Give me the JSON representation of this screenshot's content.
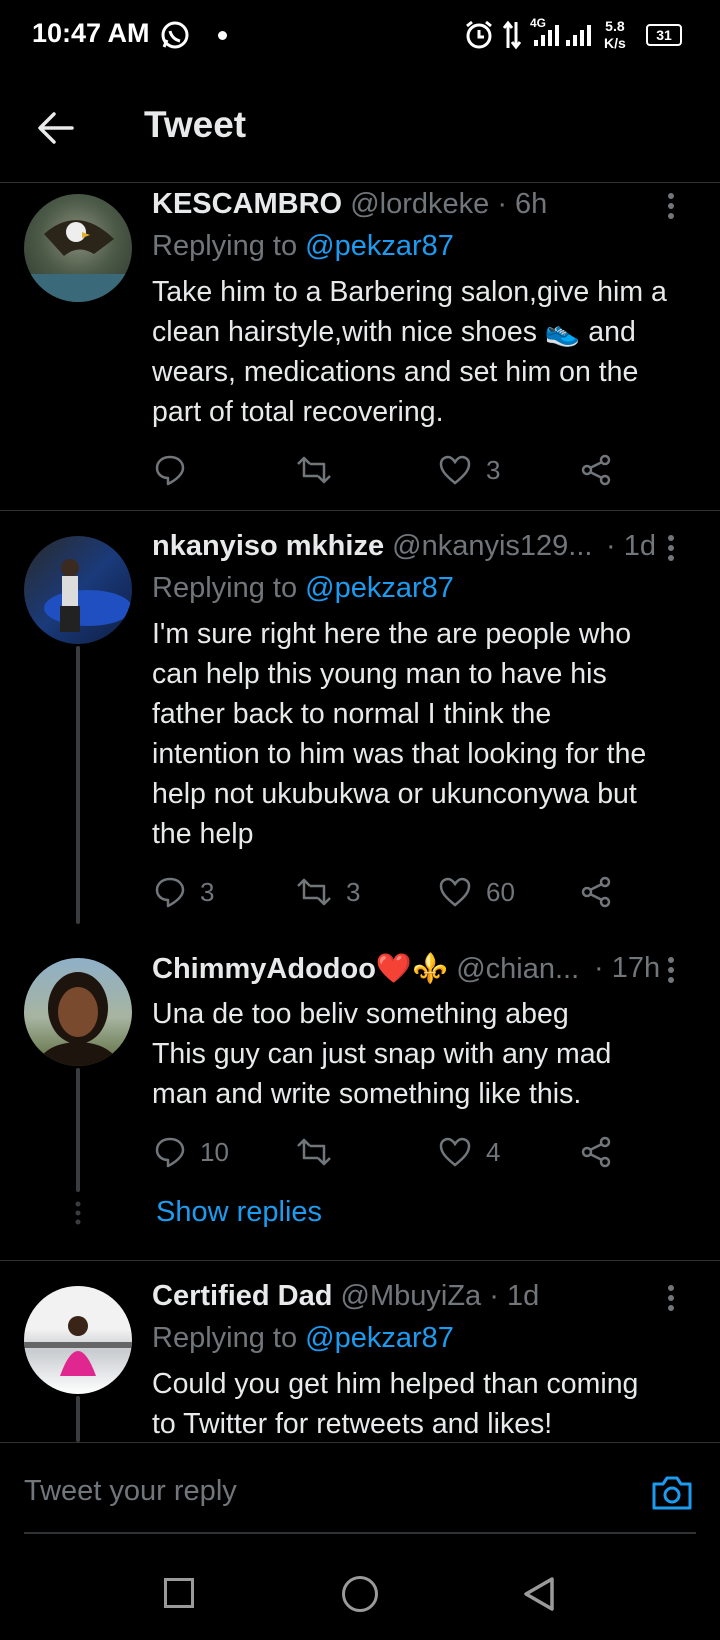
{
  "status_bar": {
    "time": "10:47 AM",
    "network": "4G",
    "speed": "5.8",
    "speed_unit": "K/s",
    "battery": "31"
  },
  "header": {
    "title": "Tweet"
  },
  "tweets": [
    {
      "name": "KESCAMBRO",
      "handle": "@lordkeke",
      "time": "· 6h",
      "replying_prefix": "Replying to",
      "replying_to": "@pekzar87",
      "lines": [
        "Take him to a Barbering salon,give him a",
        "clean hairstyle,with nice shoes 👟 and",
        "wears, medications and set him on the",
        "part of total recovering."
      ],
      "replies": "",
      "retweets": "",
      "likes": "3"
    },
    {
      "name": "nkanyiso mkhize",
      "handle": "@nkanyis129...",
      "time": "· 1d",
      "replying_prefix": "Replying to",
      "replying_to": "@pekzar87",
      "lines": [
        "I'm sure right here the are people who",
        "can help this young man to have his",
        "father back to normal I think the",
        "intention to him was that looking for the",
        "help not ukubukwa or ukunconywa but",
        "the help"
      ],
      "replies": "3",
      "retweets": "3",
      "likes": "60"
    },
    {
      "name": "ChimmyAdodoo❤️⚜️",
      "handle": "@chian...",
      "time": "· 17h",
      "lines": [
        "Una de too beliv something abeg",
        "This guy can just snap with any mad",
        "man and write something like this."
      ],
      "replies": "10",
      "retweets": "",
      "likes": "4",
      "show_replies": "Show replies"
    },
    {
      "name": "Certified Dad",
      "handle": "@MbuyiZa",
      "time": "· 1d",
      "replying_prefix": "Replying to",
      "replying_to": "@pekzar87",
      "lines": [
        "Could you get him helped than coming",
        "to Twitter for retweets and likes!"
      ]
    }
  ],
  "reply_bar": {
    "placeholder": "Tweet your reply",
    "icon": "camera-icon"
  },
  "colors": {
    "accent": "#1d9bf0",
    "background": "#000000",
    "muted": "#71767b",
    "heart": "#e0245e"
  }
}
